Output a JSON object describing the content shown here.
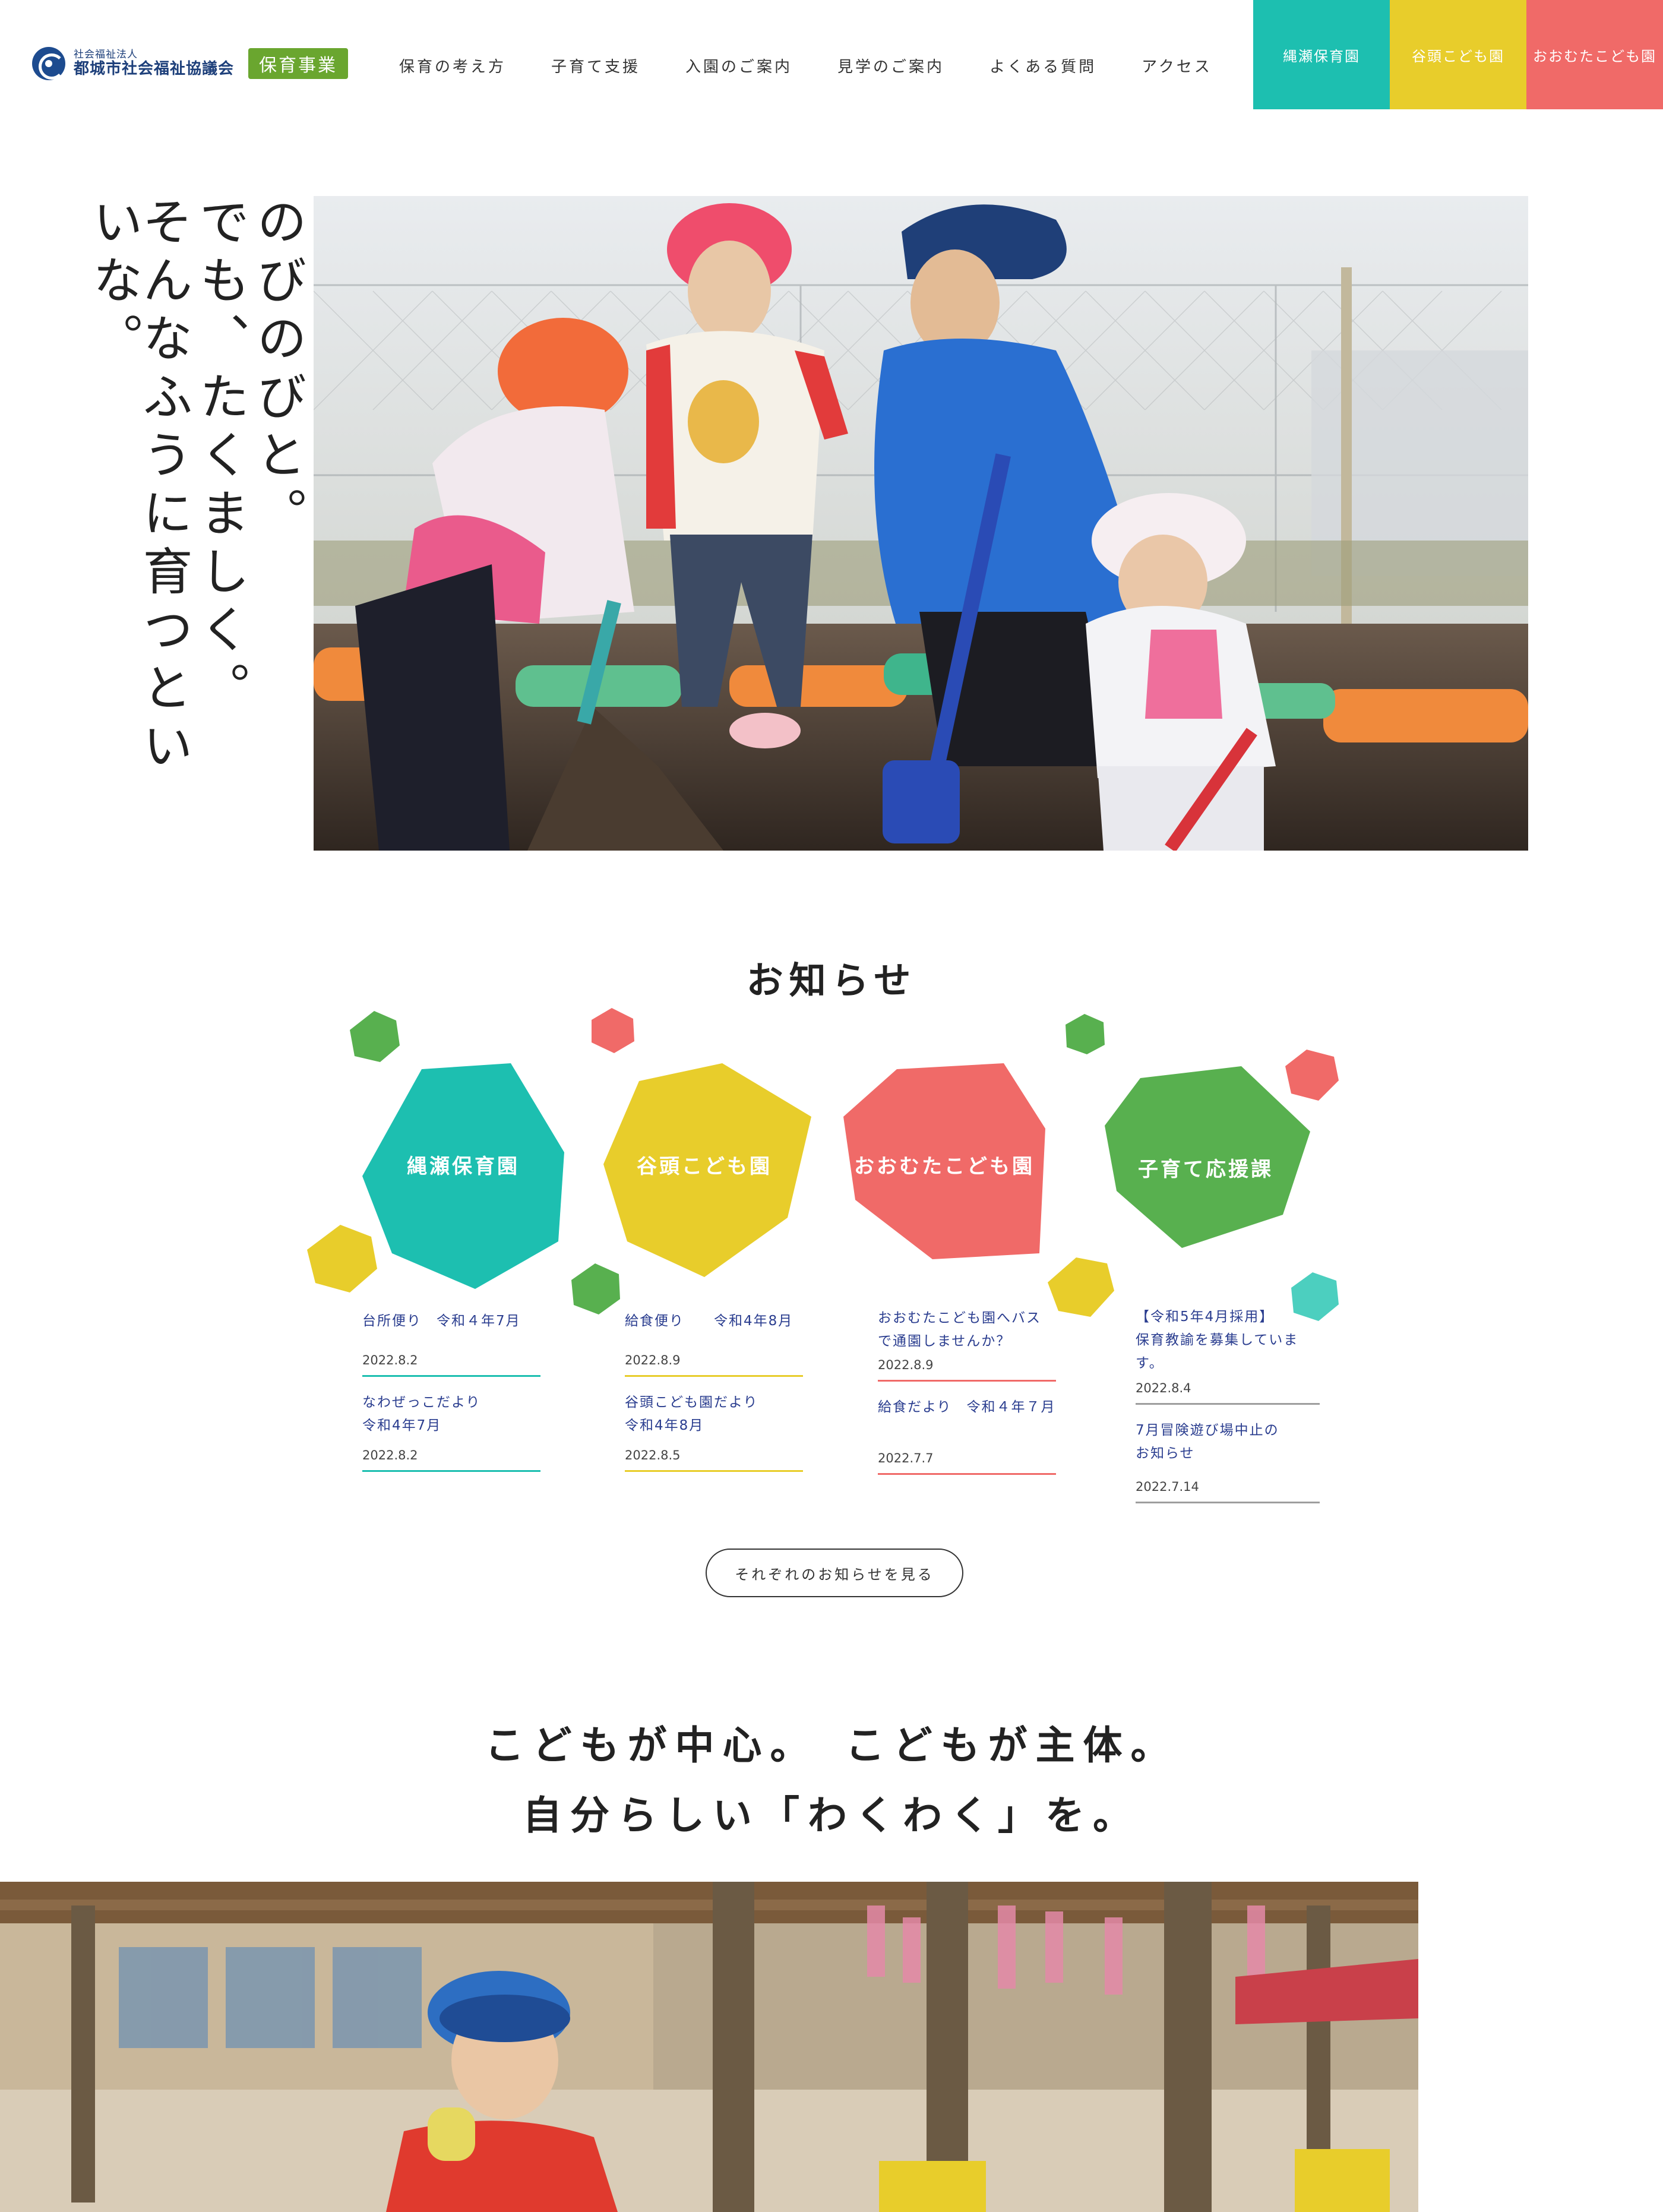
{
  "header": {
    "logo_sub": "社会福祉法人",
    "logo_main": "都城市社会福祉協議会",
    "logo_badge": "保育事業",
    "nav": [
      "保育の考え方",
      "子育て支援",
      "入園のご案内",
      "見学のご案内",
      "よくある質問",
      "アクセス"
    ],
    "park_tabs": [
      {
        "label": "縄瀬保育園",
        "color": "#1dbfb0"
      },
      {
        "label": "谷頭こども園",
        "color": "#e8cd2b"
      },
      {
        "label": "おおむたこども園",
        "color": "#f06a68"
      }
    ]
  },
  "hero": {
    "lines": [
      "のびのびと。",
      "でも、たくましく。",
      "そんなふうに育つといいな。"
    ]
  },
  "news": {
    "title": "お知らせ",
    "categories": [
      {
        "label": "縄瀬保育園",
        "color": "#1dbfb0"
      },
      {
        "label": "谷頭こども園",
        "color": "#e8cd2b"
      },
      {
        "label": "おおむたこども園",
        "color": "#f06a68"
      },
      {
        "label": "子育て応援課",
        "color": "#58b04f"
      }
    ],
    "columns": [
      {
        "color": "#1dbfb0",
        "items": [
          {
            "title": "台所便り　令和４年7月",
            "date": "2022.8.2"
          },
          {
            "title": "なわぜっこだより\n令和4年7月",
            "date": "2022.8.2"
          }
        ]
      },
      {
        "color": "#e8cd2b",
        "items": [
          {
            "title": "給食便り　　令和4年8月",
            "date": "2022.8.9"
          },
          {
            "title": "谷頭こども園だより\n令和4年8月",
            "date": "2022.8.5"
          }
        ]
      },
      {
        "color": "#f06a68",
        "items": [
          {
            "title": "おおむたこども園へバス\nで通園しませんか？",
            "date": "2022.8.9"
          },
          {
            "title": "給食だより　令和４年７月",
            "date": "2022.7.7"
          }
        ]
      },
      {
        "color": "#9e9e9e",
        "items": [
          {
            "title": "【令和5年4月採用】\n保育教諭を募集しています。",
            "date": "2022.8.4"
          },
          {
            "title": "7月冒険遊び場中止の\nお知らせ",
            "date": "2022.7.14"
          }
        ]
      }
    ],
    "more_label": "それぞれのお知らせを見る"
  },
  "slogan": {
    "line1": "こどもが中心。　こどもが主体。",
    "line2": "自分らしい「わくわく」を。"
  },
  "colors": {
    "teal": "#1dbfb0",
    "yellow": "#e8cd2b",
    "coral": "#f06a68",
    "green": "#58b04f",
    "navy_text": "#2a3d8f"
  }
}
